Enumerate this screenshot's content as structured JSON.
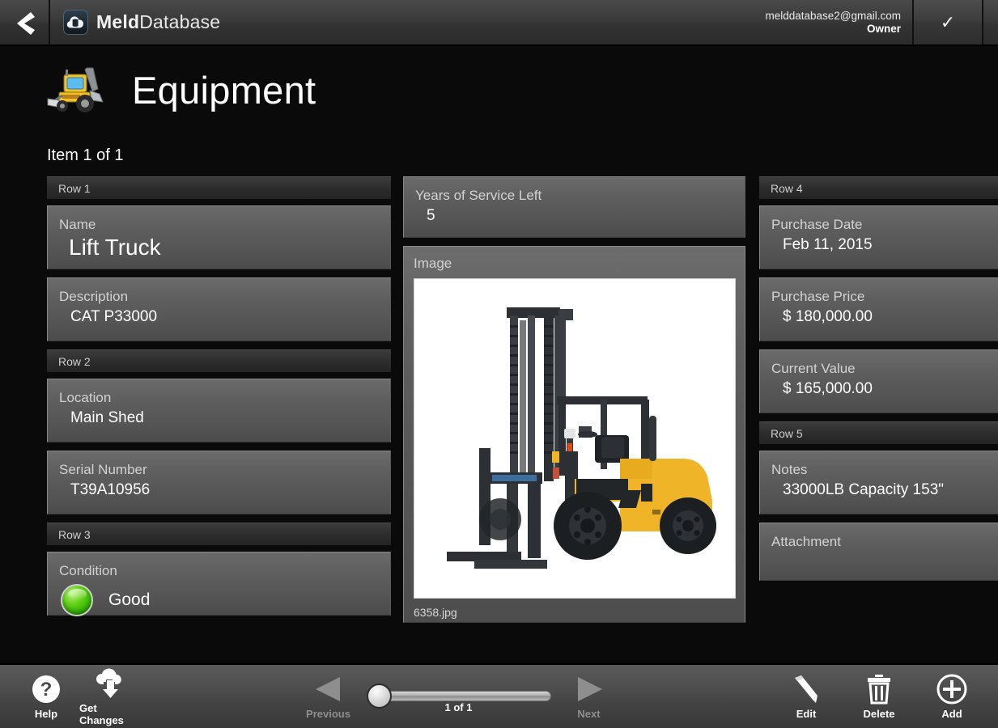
{
  "header": {
    "back_label": "Back",
    "brand_strong": "Meld",
    "brand_light": "Database",
    "account_email": "melddatabase2@gmail.com",
    "account_role": "Owner",
    "confirm_glyph": "✓",
    "logo_icon": "cloud-database-icon"
  },
  "page": {
    "title": "Equipment",
    "title_icon": "backhoe-loader-icon",
    "item_count": "Item 1 of 1"
  },
  "columns": {
    "left": [
      {
        "kind": "row-header",
        "label": "Row 1"
      },
      {
        "kind": "field",
        "label": "Name",
        "value": "Lift Truck",
        "style": "big"
      },
      {
        "kind": "field",
        "label": "Description",
        "value": "CAT P33000"
      },
      {
        "kind": "row-header",
        "label": "Row 2"
      },
      {
        "kind": "field",
        "label": "Location",
        "value": "Main Shed"
      },
      {
        "kind": "field",
        "label": "Serial Number",
        "value": "T39A10956"
      },
      {
        "kind": "row-header",
        "label": "Row 3"
      },
      {
        "kind": "condition",
        "label": "Condition",
        "value": "Good",
        "indicator_color": "#4ecf08"
      }
    ],
    "middle": [
      {
        "kind": "field",
        "label": "Years of Service Left",
        "value": "5"
      },
      {
        "kind": "image",
        "label": "Image",
        "caption": "6358.jpg",
        "image_icon": "forklift-photo"
      }
    ],
    "right": [
      {
        "kind": "row-header",
        "label": "Row 4"
      },
      {
        "kind": "field",
        "label": "Purchase Date",
        "value": "Feb 11, 2015"
      },
      {
        "kind": "field",
        "label": "Purchase Price",
        "value": "$ 180,000.00"
      },
      {
        "kind": "field",
        "label": "Current Value",
        "value": "$ 165,000.00"
      },
      {
        "kind": "row-header",
        "label": "Row 5"
      },
      {
        "kind": "field",
        "label": "Notes",
        "value": "33000LB Capacity 153\""
      },
      {
        "kind": "field",
        "label": "Attachment",
        "value": ""
      }
    ]
  },
  "toolbar": {
    "help_label": "Help",
    "help_icon": "question-circle-icon",
    "get_changes_label": "Get Changes",
    "get_changes_icon": "cloud-download-icon",
    "previous_label": "Previous",
    "previous_icon": "triangle-left-icon",
    "next_label": "Next",
    "next_icon": "triangle-right-icon",
    "slider_count": "1 of 1",
    "edit_label": "Edit",
    "edit_icon": "pencil-icon",
    "delete_label": "Delete",
    "delete_icon": "trash-icon",
    "add_label": "Add",
    "add_icon": "plus-circle-icon"
  },
  "colors": {
    "accent_green": "#4ecf08",
    "card_bg": "#5e5e5e",
    "page_bg": "#0a0a0a",
    "header_bg": "#3a3a3a"
  }
}
